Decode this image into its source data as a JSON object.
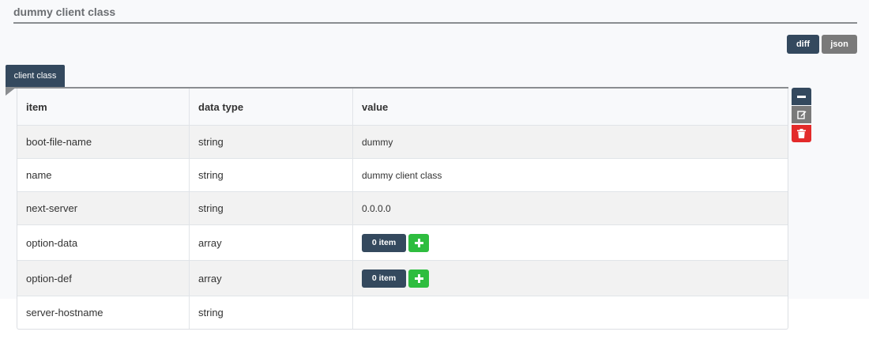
{
  "header": {
    "title": "dummy client class",
    "diff_label": "diff",
    "json_label": "json"
  },
  "section": {
    "tab_label": "client class"
  },
  "table": {
    "columns": [
      "item",
      "data type",
      "value"
    ],
    "rows": [
      {
        "item": "boot-file-name",
        "type": "string",
        "value": "dummy"
      },
      {
        "item": "name",
        "type": "string",
        "value": "dummy client class"
      },
      {
        "item": "next-server",
        "type": "string",
        "value": "0.0.0.0"
      },
      {
        "item": "option-data",
        "type": "array",
        "count_label": "0 item"
      },
      {
        "item": "option-def",
        "type": "array",
        "count_label": "0 item"
      },
      {
        "item": "server-hostname",
        "type": "string",
        "value": ""
      }
    ]
  },
  "icons": {
    "add": "plus-icon",
    "collapse": "minus-icon",
    "edit": "edit-icon",
    "delete": "trash-icon"
  },
  "colors": {
    "primary": "#34495e",
    "secondary": "#7a7a7a",
    "success": "#2ebd3f",
    "danger": "#e32a2a"
  }
}
